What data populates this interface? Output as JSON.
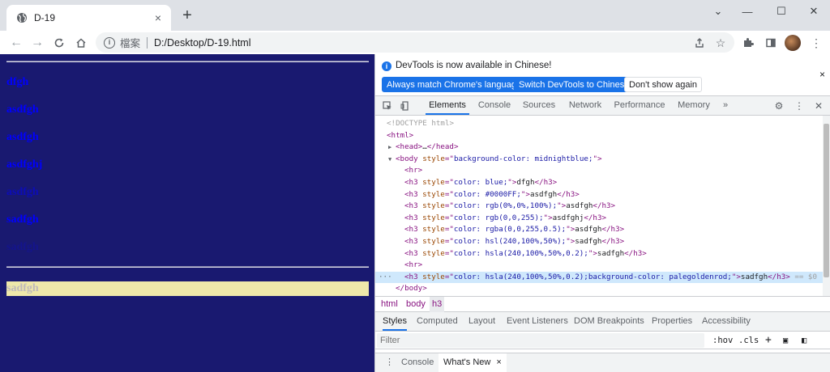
{
  "browser": {
    "tab_title": "D-19",
    "tab_close": "×",
    "new_tab": "+",
    "window": {
      "minimize": "—",
      "maximize": "☐",
      "close": "✕",
      "chevron": "⌄"
    },
    "omnibox": {
      "label": "檔案",
      "url": "D:/Desktop/D-19.html"
    }
  },
  "page": {
    "background": "#191970",
    "headings": [
      {
        "text": "dfgh",
        "color": "#0000ff"
      },
      {
        "text": "asdfgh",
        "color": "#0000ff"
      },
      {
        "text": "asdfgh",
        "color": "#0000ff"
      },
      {
        "text": "asdfghj",
        "color": "#0000ff"
      },
      {
        "text": "asdfgh",
        "color": "rgba(0,0,255,0.5)"
      },
      {
        "text": "sadfgh",
        "color": "#0000ff"
      },
      {
        "text": "sadfgh",
        "color": "hsla(240,100%,50%,0.2)"
      },
      {
        "text": "sadfgh",
        "color": "hsla(240,100%,50%,0.2)",
        "background": "#eee8aa"
      }
    ]
  },
  "devtools": {
    "banner": {
      "message": "DevTools is now available in Chinese!",
      "btn_match": "Always match Chrome's language",
      "btn_switch": "Switch DevTools to Chinese",
      "btn_dismiss": "Don't show again",
      "close": "×"
    },
    "tabs": [
      "Elements",
      "Console",
      "Sources",
      "Network",
      "Performance",
      "Memory"
    ],
    "more_tabs": "»",
    "dom_lines": [
      {
        "indent": 0,
        "tri": "",
        "parts": [
          [
            "cmt",
            "<!DOCTYPE html>"
          ]
        ]
      },
      {
        "indent": 0,
        "tri": "",
        "parts": [
          [
            "tagc",
            "<html>"
          ]
        ]
      },
      {
        "indent": 1,
        "tri": "▶",
        "parts": [
          [
            "tagc",
            "<head>"
          ],
          [
            "txt",
            "…"
          ],
          [
            "tagc",
            "</head>"
          ]
        ]
      },
      {
        "indent": 1,
        "tri": "▼",
        "parts": [
          [
            "tagc",
            "<body "
          ],
          [
            "attrn",
            "style"
          ],
          [
            "tagc",
            "=\""
          ],
          [
            "attrv",
            "background-color: midnightblue;"
          ],
          [
            "tagc",
            "\">"
          ]
        ]
      },
      {
        "indent": 2,
        "tri": "",
        "parts": [
          [
            "tagc",
            "<hr>"
          ]
        ]
      },
      {
        "indent": 2,
        "tri": "",
        "parts": [
          [
            "tagc",
            "<h3 "
          ],
          [
            "attrn",
            "style"
          ],
          [
            "tagc",
            "=\""
          ],
          [
            "attrv",
            "color: blue;"
          ],
          [
            "tagc",
            "\">"
          ],
          [
            "txt",
            "dfgh"
          ],
          [
            "tagc",
            "</h3>"
          ]
        ]
      },
      {
        "indent": 2,
        "tri": "",
        "parts": [
          [
            "tagc",
            "<h3 "
          ],
          [
            "attrn",
            "style"
          ],
          [
            "tagc",
            "=\""
          ],
          [
            "attrv",
            "color: #0000FF;"
          ],
          [
            "tagc",
            "\">"
          ],
          [
            "txt",
            "asdfgh"
          ],
          [
            "tagc",
            "</h3>"
          ]
        ]
      },
      {
        "indent": 2,
        "tri": "",
        "parts": [
          [
            "tagc",
            "<h3 "
          ],
          [
            "attrn",
            "style"
          ],
          [
            "tagc",
            "=\""
          ],
          [
            "attrv",
            "color: rgb(0%,0%,100%);"
          ],
          [
            "tagc",
            "\">"
          ],
          [
            "txt",
            "asdfgh"
          ],
          [
            "tagc",
            "</h3>"
          ]
        ]
      },
      {
        "indent": 2,
        "tri": "",
        "parts": [
          [
            "tagc",
            "<h3 "
          ],
          [
            "attrn",
            "style"
          ],
          [
            "tagc",
            "=\""
          ],
          [
            "attrv",
            "color: rgb(0,0,255);"
          ],
          [
            "tagc",
            "\">"
          ],
          [
            "txt",
            "asdfghj"
          ],
          [
            "tagc",
            "</h3>"
          ]
        ]
      },
      {
        "indent": 2,
        "tri": "",
        "parts": [
          [
            "tagc",
            "<h3 "
          ],
          [
            "attrn",
            "style"
          ],
          [
            "tagc",
            "=\""
          ],
          [
            "attrv",
            "color: rgba(0,0,255,0.5);"
          ],
          [
            "tagc",
            "\">"
          ],
          [
            "txt",
            "asdfgh"
          ],
          [
            "tagc",
            "</h3>"
          ]
        ]
      },
      {
        "indent": 2,
        "tri": "",
        "parts": [
          [
            "tagc",
            "<h3 "
          ],
          [
            "attrn",
            "style"
          ],
          [
            "tagc",
            "=\""
          ],
          [
            "attrv",
            "color: hsl(240,100%,50%);"
          ],
          [
            "tagc",
            "\">"
          ],
          [
            "txt",
            "sadfgh"
          ],
          [
            "tagc",
            "</h3>"
          ]
        ]
      },
      {
        "indent": 2,
        "tri": "",
        "parts": [
          [
            "tagc",
            "<h3 "
          ],
          [
            "attrn",
            "style"
          ],
          [
            "tagc",
            "=\""
          ],
          [
            "attrv",
            "color: hsla(240,100%,50%,0.2);"
          ],
          [
            "tagc",
            "\">"
          ],
          [
            "txt",
            "sadfgh"
          ],
          [
            "tagc",
            "</h3>"
          ]
        ]
      },
      {
        "indent": 2,
        "tri": "",
        "parts": [
          [
            "tagc",
            "<hr>"
          ]
        ]
      },
      {
        "indent": 2,
        "tri": "",
        "sel": true,
        "parts": [
          [
            "tagc",
            "<h3 "
          ],
          [
            "attrn",
            "style"
          ],
          [
            "tagc",
            "=\""
          ],
          [
            "attrv",
            "color: hsla(240,100%,50%,0.2);background-color: palegoldenrod;"
          ],
          [
            "tagc",
            "\">"
          ],
          [
            "txt",
            "sadfgh"
          ],
          [
            "tagc",
            "</h3>"
          ],
          [
            "cmt",
            " == $0"
          ]
        ]
      },
      {
        "indent": 1,
        "tri": "",
        "parts": [
          [
            "tagc",
            "</body>"
          ]
        ]
      }
    ],
    "selected_ellipsis": "···",
    "breadcrumbs": [
      "html",
      "body",
      "h3"
    ],
    "style_tabs": [
      "Styles",
      "Computed",
      "Layout",
      "Event Listeners",
      "DOM Breakpoints",
      "Properties",
      "Accessibility"
    ],
    "filter": {
      "placeholder": "Filter",
      "hov": ":hov",
      "cls": ".cls",
      "plus": "+"
    },
    "drawer": {
      "console": "Console",
      "whats_new": "What's New",
      "close": "×",
      "menu": "⋮"
    }
  }
}
